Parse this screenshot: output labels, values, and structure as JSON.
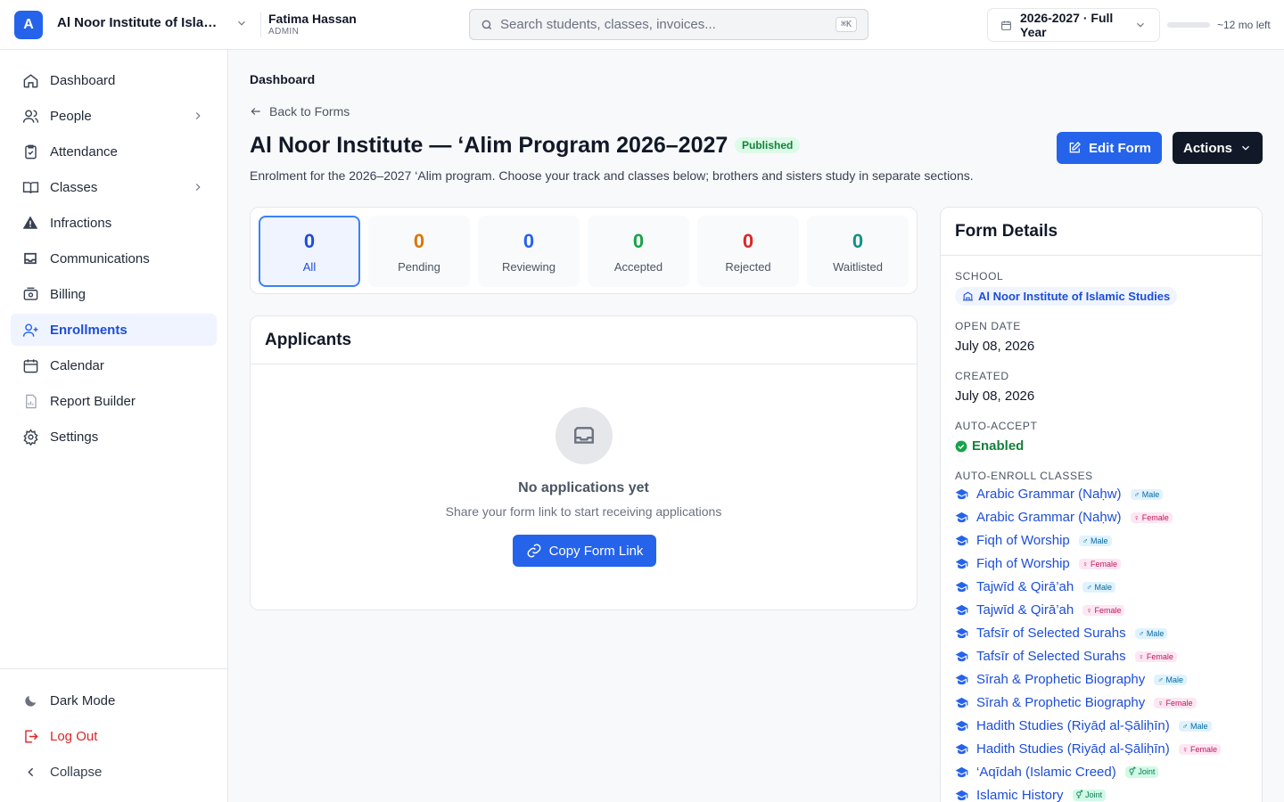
{
  "topbar": {
    "logo_letter": "A",
    "school_name": "Al Noor Institute of Islamic Studies",
    "user_name": "Fatima Hassan",
    "user_role": "ADMIN",
    "search_placeholder": "Search students, classes, invoices...",
    "search_shortcut": "⌘K",
    "year_label": "2026-2027 · Full Year",
    "year_progress_fraction": 0.0,
    "time_left": "~12 mo left"
  },
  "sidebar": {
    "items": [
      {
        "label": "Dashboard",
        "icon": "home-icon"
      },
      {
        "label": "People",
        "icon": "users-icon"
      },
      {
        "label": "Attendance",
        "icon": "clipboard-check-icon"
      },
      {
        "label": "Classes",
        "icon": "book-open-icon"
      },
      {
        "label": "Infractions",
        "icon": "warning-icon"
      },
      {
        "label": "Communications",
        "icon": "inbox-icon"
      },
      {
        "label": "Billing",
        "icon": "billing-icon"
      },
      {
        "label": "Enrollments",
        "icon": "user-plus-icon"
      },
      {
        "label": "Calendar",
        "icon": "calendar-icon"
      },
      {
        "label": "Report Builder",
        "icon": "report-icon"
      },
      {
        "label": "Settings",
        "icon": "gear-icon"
      }
    ],
    "bottom": {
      "dark_mode": "Dark Mode",
      "logout": "Log Out",
      "collapse": "Collapse"
    }
  },
  "main": {
    "breadcrumb": "Dashboard",
    "back_link": "Back to Forms",
    "title": "Al Noor Institute — ‘Alim Program 2026–2027",
    "status_badge": "Published",
    "description": "Enrolment for the 2026–2027 ‘Alim program. Choose your track and classes below; brothers and sisters study in separate sections.",
    "edit_button": "Edit Form",
    "actions_button": "Actions",
    "stats": [
      {
        "value": "0",
        "label": "All",
        "color": "#1d4ed8"
      },
      {
        "value": "0",
        "label": "Pending",
        "color": "#d97706"
      },
      {
        "value": "0",
        "label": "Reviewing",
        "color": "#2563eb"
      },
      {
        "value": "0",
        "label": "Accepted",
        "color": "#16a34a"
      },
      {
        "value": "0",
        "label": "Rejected",
        "color": "#dc2626"
      },
      {
        "value": "0",
        "label": "Waitlisted",
        "color": "#0d9488"
      }
    ],
    "applicants": {
      "heading": "Applicants",
      "empty_title": "No applications yet",
      "empty_sub": "Share your form link to start receiving applications",
      "copy_button": "Copy Form Link"
    }
  },
  "details": {
    "heading": "Form Details",
    "school_label": "SCHOOL",
    "school_value": "Al Noor Institute of Islamic Studies",
    "open_date_label": "OPEN DATE",
    "open_date_value": "July 08, 2026",
    "created_label": "CREATED",
    "created_value": "July 08, 2026",
    "auto_accept_label": "AUTO-ACCEPT",
    "auto_accept_value": "Enabled",
    "auto_enroll_label": "AUTO-ENROLL CLASSES",
    "classes": [
      {
        "name": "Arabic Grammar (Naḥw)",
        "tag": "♂ Male",
        "kind": "male"
      },
      {
        "name": "Arabic Grammar (Naḥw)",
        "tag": "♀ Female",
        "kind": "female"
      },
      {
        "name": "Fiqh of Worship",
        "tag": "♂ Male",
        "kind": "male"
      },
      {
        "name": "Fiqh of Worship",
        "tag": "♀ Female",
        "kind": "female"
      },
      {
        "name": "Tajwīd & Qirā’ah",
        "tag": "♂ Male",
        "kind": "male"
      },
      {
        "name": "Tajwīd & Qirā’ah",
        "tag": "♀ Female",
        "kind": "female"
      },
      {
        "name": "Tafsīr of Selected Surahs",
        "tag": "♂ Male",
        "kind": "male"
      },
      {
        "name": "Tafsīr of Selected Surahs",
        "tag": "♀ Female",
        "kind": "female"
      },
      {
        "name": "Sīrah & Prophetic Biography",
        "tag": "♂ Male",
        "kind": "male"
      },
      {
        "name": "Sīrah & Prophetic Biography",
        "tag": "♀ Female",
        "kind": "female"
      },
      {
        "name": "Hadith Studies (Riyāḍ al-Ṣāliḥīn)",
        "tag": "♂ Male",
        "kind": "male"
      },
      {
        "name": "Hadith Studies (Riyāḍ al-Ṣāliḥīn)",
        "tag": "♀ Female",
        "kind": "female"
      },
      {
        "name": "‘Aqīdah (Islamic Creed)",
        "tag": "⚥ Joint",
        "kind": "joint"
      },
      {
        "name": "Islamic History",
        "tag": "⚥ Joint",
        "kind": "joint"
      }
    ]
  }
}
